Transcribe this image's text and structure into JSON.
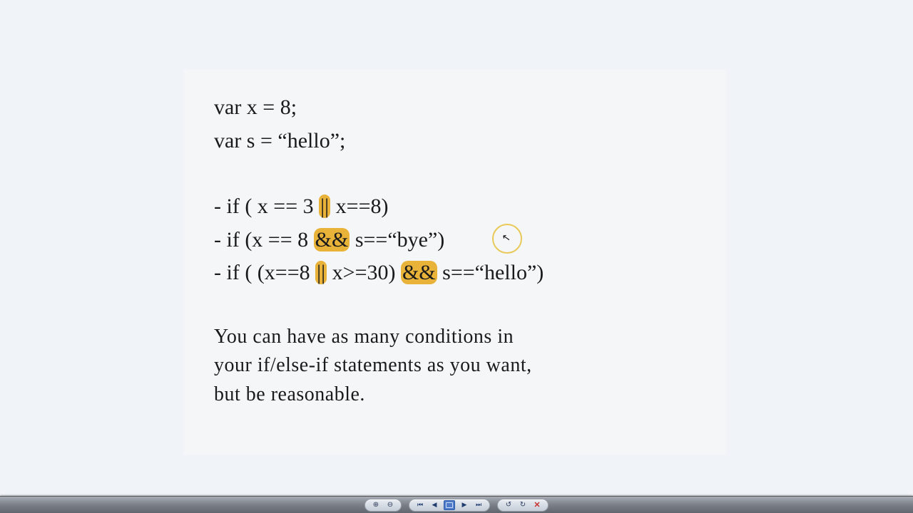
{
  "slide": {
    "code1": "var x = 8;",
    "code2": "var s = “hello”;",
    "line1": {
      "pre": "- if ( x == 3 ",
      "hl": "||",
      "post": " x==8)"
    },
    "line2": {
      "pre": "- if (x == 8 ",
      "hl": "&&",
      "post": " s==“bye”)"
    },
    "line3": {
      "pre": "- if ( (x==8 ",
      "hl1": "||",
      "mid": " x>=30) ",
      "hl2": "&&",
      "post": " s==“hello”)"
    },
    "paragraph_a": "You can have as many conditions in",
    "paragraph_b": "your if/else-if statements as you want,",
    "paragraph_c": "but be reasonable."
  },
  "toolbar": {
    "zoom_in": "⊕",
    "zoom_out": "⊖",
    "first": "⏮",
    "prev": "◀",
    "slide": "▣",
    "next": "▶",
    "last": "⏭",
    "pen": "↻",
    "redo": "↺",
    "close": "✕"
  }
}
